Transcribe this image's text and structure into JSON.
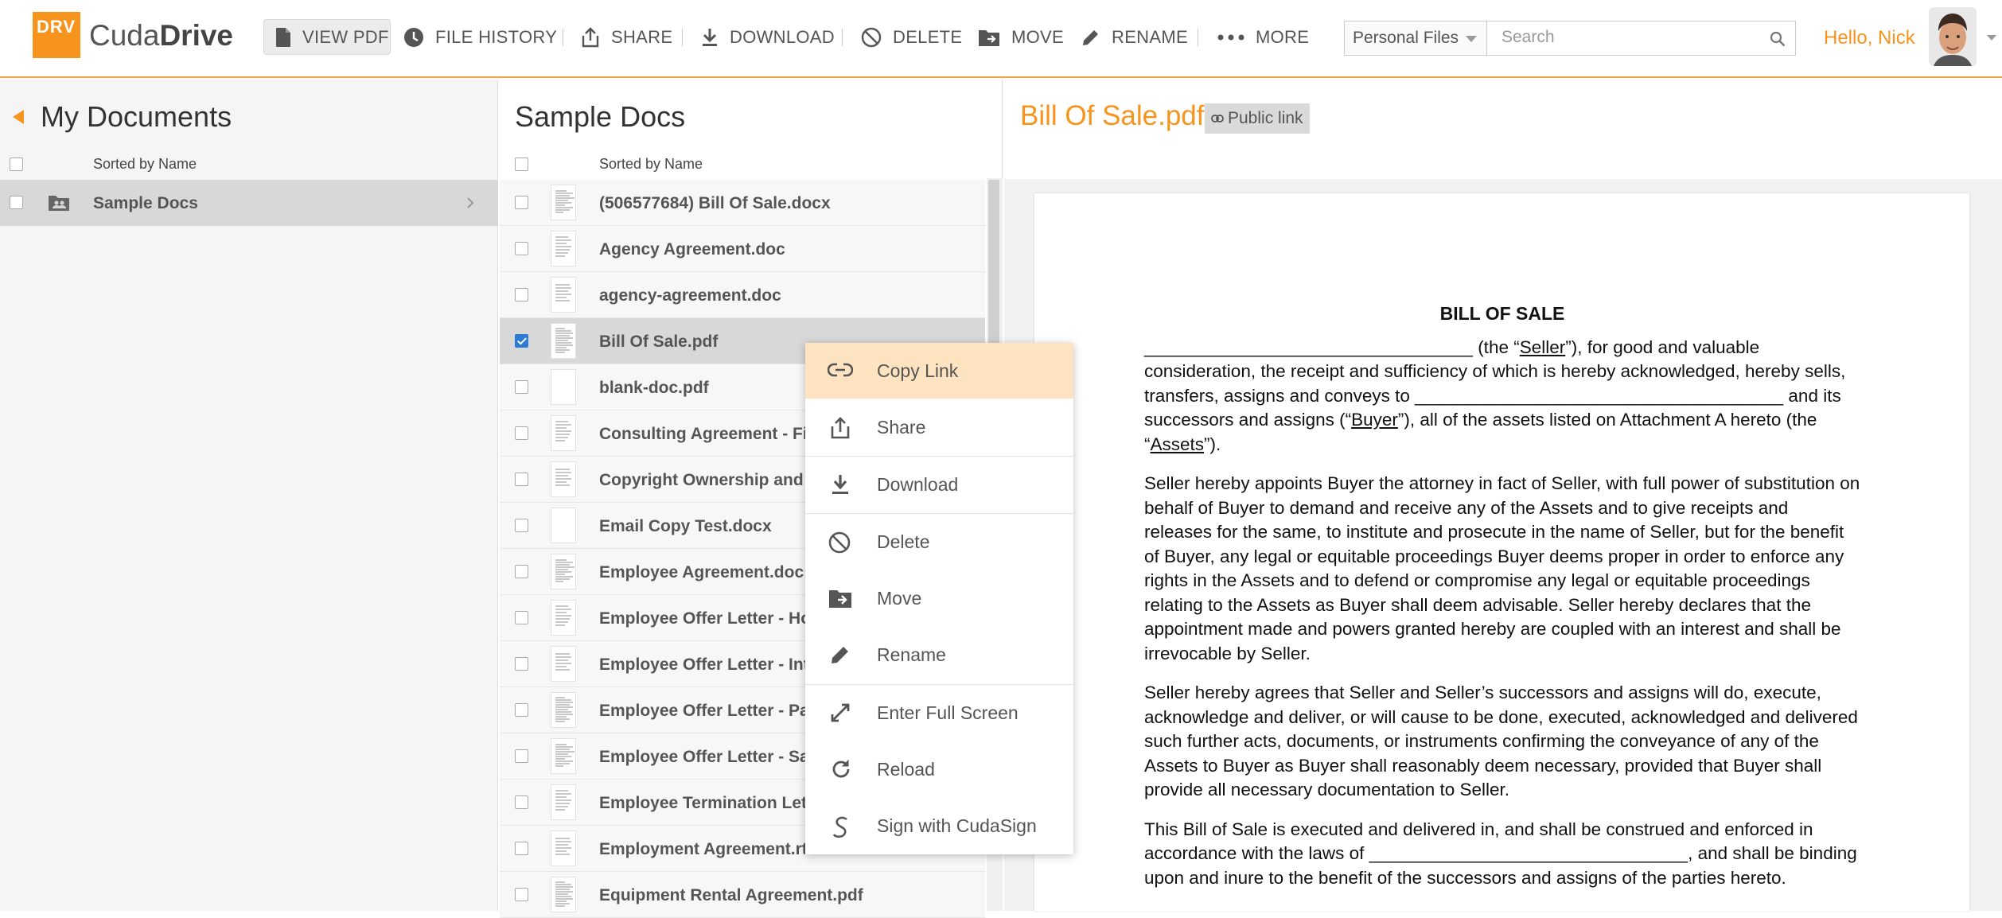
{
  "app": {
    "logo_mark": "DRV",
    "name_light": "Cuda",
    "name_bold": "Drive"
  },
  "toolbar": {
    "view_pdf": "VIEW PDF",
    "file_history": "FILE HISTORY",
    "share": "SHARE",
    "download": "DOWNLOAD",
    "delete": "DELETE",
    "move": "MOVE",
    "rename": "RENAME",
    "more": "MORE"
  },
  "scope_select": {
    "value": "Personal Files"
  },
  "search": {
    "placeholder": "Search"
  },
  "user": {
    "greeting": "Hello, Nick"
  },
  "left_pane": {
    "title": "My Documents",
    "sort_label": "Sorted by Name",
    "folders": [
      {
        "name": "Sample Docs"
      }
    ]
  },
  "middle_pane": {
    "title": "Sample Docs",
    "sort_label": "Sorted by Name",
    "files": [
      {
        "name": "(506577684) Bill Of Sale.docx"
      },
      {
        "name": "Agency Agreement.doc"
      },
      {
        "name": "agency-agreement.doc"
      },
      {
        "name": "Bill Of Sale.pdf"
      },
      {
        "name": "blank-doc.pdf"
      },
      {
        "name": "Consulting Agreement - Fix"
      },
      {
        "name": "Copyright Ownership and Li"
      },
      {
        "name": "Email Copy Test.docx"
      },
      {
        "name": "Employee Agreement.doc"
      },
      {
        "name": "Employee Offer Letter - Hou"
      },
      {
        "name": "Employee Offer Letter - Inte"
      },
      {
        "name": "Employee Offer Letter - Par"
      },
      {
        "name": "Employee Offer Letter - Sala"
      },
      {
        "name": "Employee Termination Lette"
      },
      {
        "name": "Employment Agreement.rtf"
      },
      {
        "name": "Equipment Rental Agreement.pdf"
      }
    ]
  },
  "preview": {
    "title": "Bill Of Sale.pdf",
    "public_link": "Public link",
    "doc": {
      "heading": "BILL OF SALE",
      "p1_a": "_________________________________ (the “",
      "p1_seller": "Seller",
      "p1_b": "”), for good and valuable consideration, the receipt and sufficiency of which is hereby acknowledged, hereby sells, transfers, assigns and conveys to _____________________________________ and its successors and assigns (“",
      "p1_buyer": "Buyer",
      "p1_c": "”), all of the assets listed on Attachment A hereto (the “",
      "p1_assets": "Assets",
      "p1_d": "”).",
      "p2": "Seller hereby appoints Buyer the attorney in fact of Seller, with full power of substitution on behalf of Buyer to demand and receive any of the Assets and to give receipts and releases for the same, to institute and prosecute in the name of Seller, but for the benefit of Buyer, any legal or equitable proceedings Buyer deems proper in order to enforce any rights in the Assets and to defend or compromise any legal or equitable proceedings relating to the Assets as Buyer shall deem advisable. Seller hereby declares that the appointment made and powers granted hereby are coupled with an interest and shall be irrevocable by Seller.",
      "p3": "Seller hereby agrees that Seller and Seller’s successors and assigns will do, execute, acknowledge and deliver, or will cause to be done, executed, acknowledged and delivered such further acts, documents, or instruments confirming the conveyance of any of the Assets to Buyer as Buyer shall reasonably deem necessary, provided that Buyer shall provide all necessary documentation to Seller.",
      "p4": "This Bill of Sale is executed and delivered in, and shall be construed and enforced in accordance with the laws of ________________________________, and shall be binding upon and inure to the benefit of the successors and assigns of the parties hereto."
    }
  },
  "context_menu": {
    "copy_link": "Copy Link",
    "share": "Share",
    "download": "Download",
    "delete": "Delete",
    "move": "Move",
    "rename": "Rename",
    "full_screen": "Enter Full Screen",
    "reload": "Reload",
    "sign": "Sign with CudaSign"
  },
  "colors": {
    "accent": "#f7941d",
    "highlight": "#fde3bf",
    "selected_row": "#d8d8d8"
  }
}
